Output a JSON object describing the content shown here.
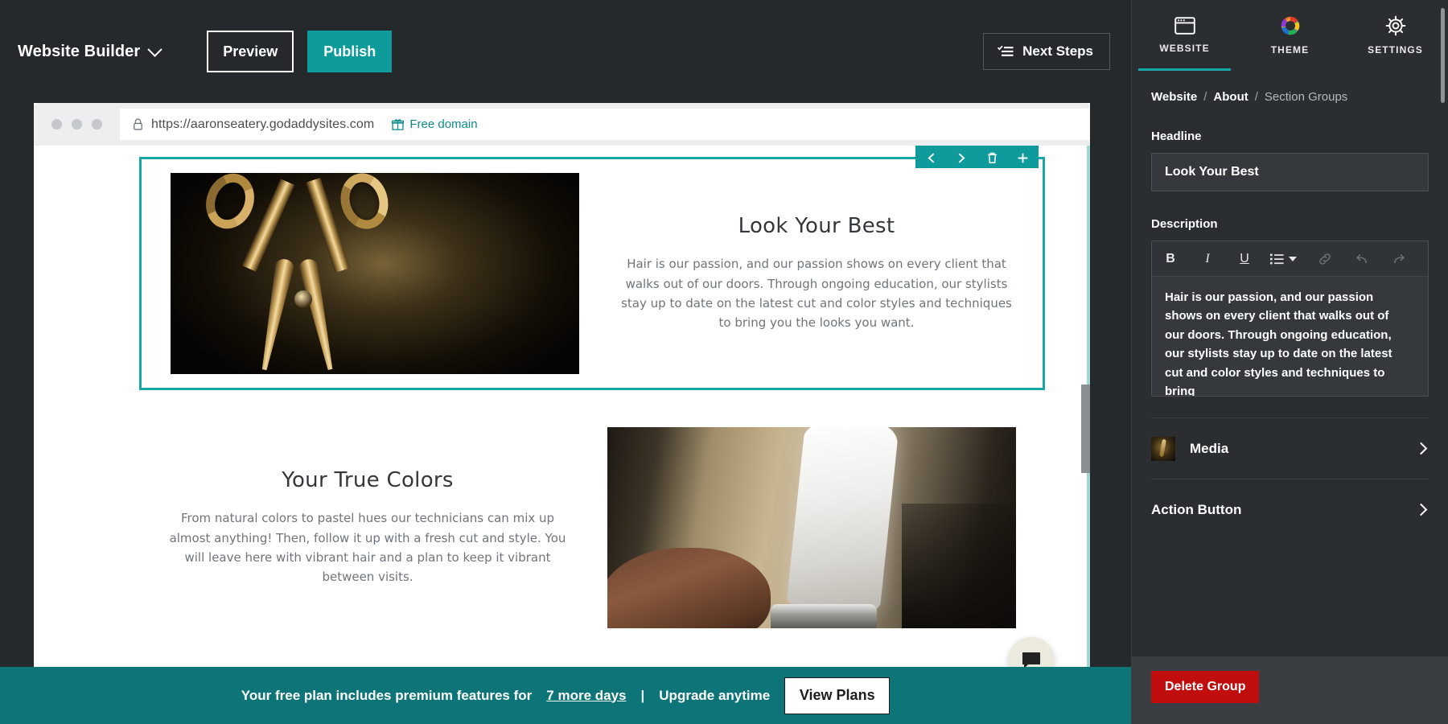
{
  "topbar": {
    "brand": "Website Builder",
    "preview_label": "Preview",
    "publish_label": "Publish",
    "next_steps_label": "Next Steps"
  },
  "browser": {
    "url": "https://aaronseatery.godaddysites.com",
    "free_domain_label": "Free domain"
  },
  "canvas": {
    "section_one": {
      "heading": "Look Your Best",
      "body": "Hair is our passion, and our passion shows on every client that walks out of our doors. Through ongoing education, our stylists stay up to date on the latest cut and color styles and techniques to bring you the looks you want."
    },
    "section_two": {
      "heading": "Your True Colors",
      "body": "From natural colors to pastel hues our technicians can mix up almost anything! Then, follow it up with a fresh cut and style. You will leave here with vibrant hair and a plan to keep it vibrant between visits."
    }
  },
  "promo": {
    "text_before": "Your free plan includes premium features for",
    "link": "7 more days",
    "separator": "|",
    "text_after": "Upgrade anytime",
    "view_plans_label": "View Plans"
  },
  "panel": {
    "tabs": [
      {
        "label": "WEBSITE",
        "icon": "browser-window-icon",
        "active": true
      },
      {
        "label": "THEME",
        "icon": "color-wheel-icon",
        "active": false
      },
      {
        "label": "SETTINGS",
        "icon": "gear-icon",
        "active": false
      }
    ],
    "breadcrumb": {
      "root": "Website",
      "sep1": "/",
      "middle": "About",
      "sep2": "/",
      "current": "Section Groups"
    },
    "headline": {
      "label": "Headline",
      "value": "Look Your Best"
    },
    "description": {
      "label": "Description",
      "value": "Hair is our passion, and our passion shows on every client that walks out of our doors. Through ongoing education, our stylists stay up to date on the latest cut and color styles and techniques to bring",
      "toolbar": [
        {
          "name": "bold",
          "glyph": "B"
        },
        {
          "name": "italic",
          "glyph": "I"
        },
        {
          "name": "underline",
          "glyph": "U"
        },
        {
          "name": "list",
          "glyph": "☰"
        },
        {
          "name": "link",
          "glyph": "🔗"
        },
        {
          "name": "undo",
          "glyph": "↶"
        },
        {
          "name": "redo",
          "glyph": "↷"
        }
      ]
    },
    "rows": [
      {
        "label": "Media"
      },
      {
        "label": "Action Button"
      }
    ],
    "delete_label": "Delete Group"
  },
  "colors": {
    "accent_teal": "#0d9b9b",
    "selection_teal": "#16a7a7",
    "promo_teal": "#0d7478",
    "danger_red": "#c00d0d",
    "panel_bg": "#2b2e31",
    "chrome_bg": "#26292c"
  }
}
